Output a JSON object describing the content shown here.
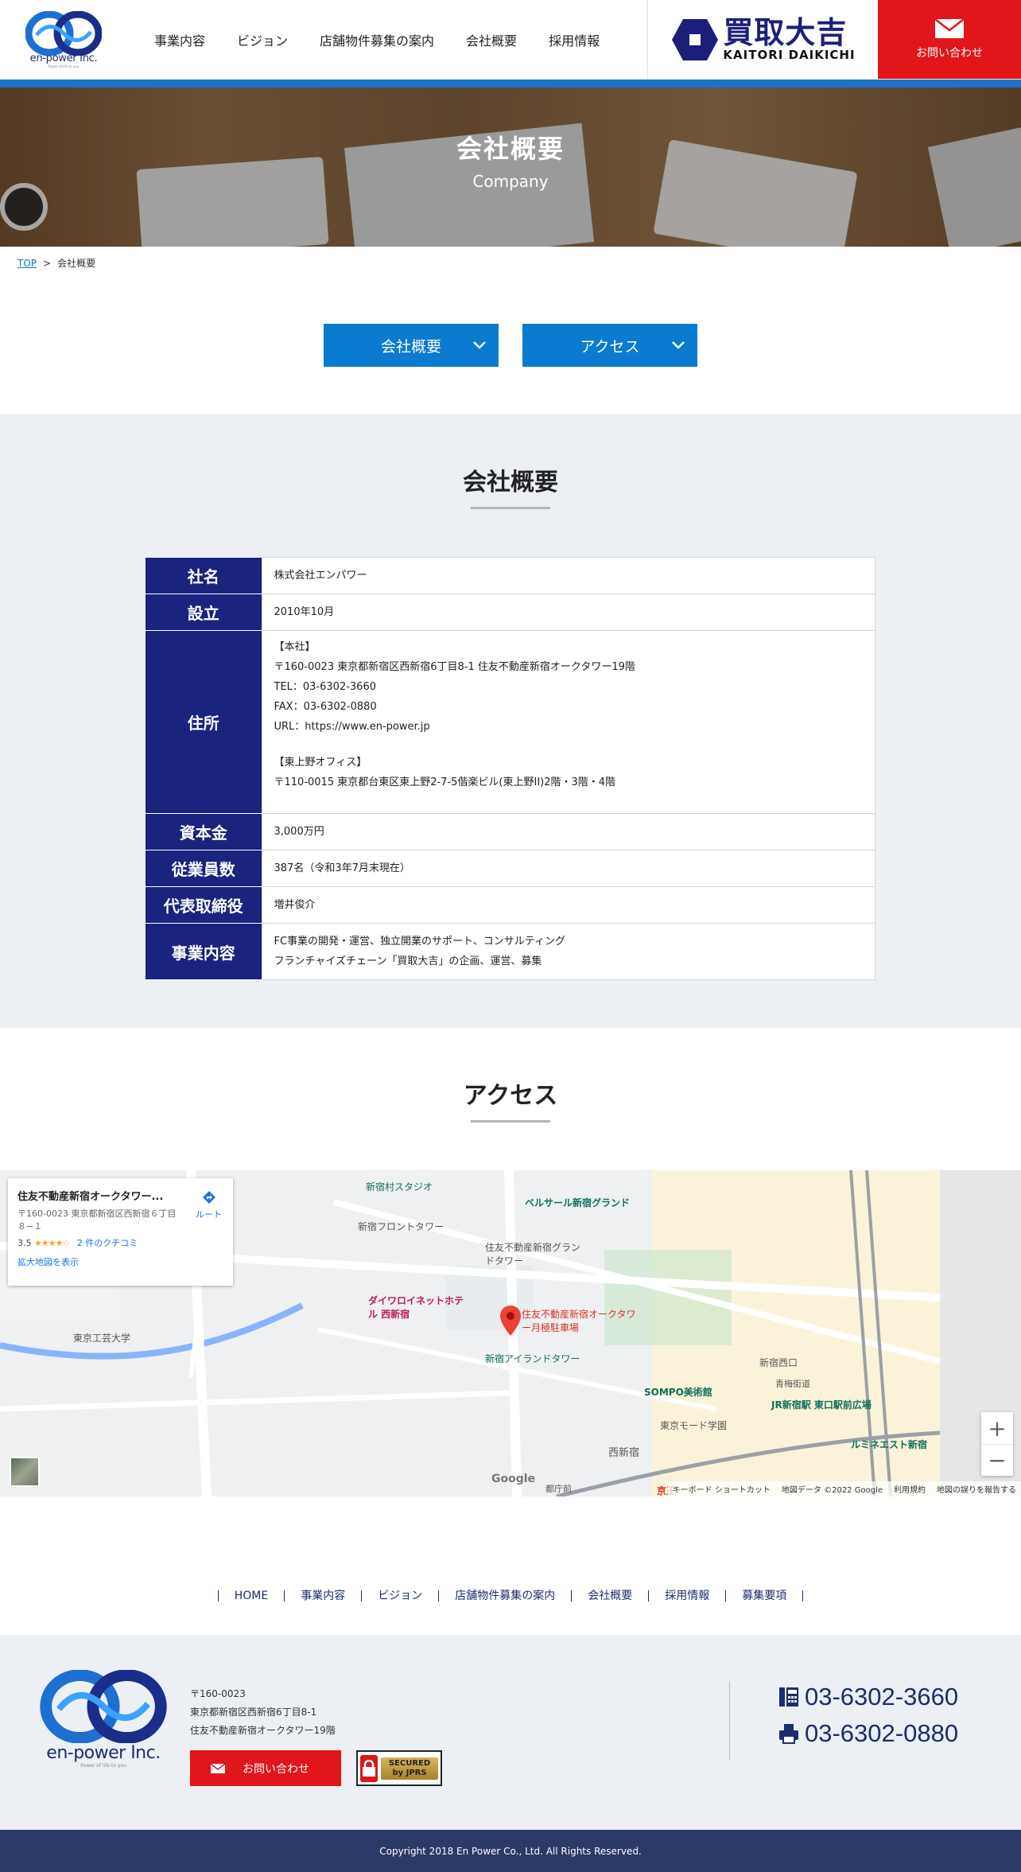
{
  "header": {
    "logo_text": "en-power Inc.",
    "logo_sub": "Power of life to you",
    "nav": [
      "事業内容",
      "ビジョン",
      "店舗物件募集の案内",
      "会社概要",
      "採用情報"
    ],
    "brand_jp": "買取大吉",
    "brand_en": "KAITORI DAIKICHI",
    "contact_label": "お問い合わせ"
  },
  "hero": {
    "title": "会社概要",
    "subtitle": "Company"
  },
  "breadcrumb": {
    "top": "TOP",
    "current": "会社概要"
  },
  "anchors": [
    "会社概要",
    "アクセス"
  ],
  "company": {
    "title": "会社概要",
    "rows": [
      {
        "label": "社名",
        "value": "株式会社エンパワー"
      },
      {
        "label": "設立",
        "value": "2010年10月"
      },
      {
        "label": "資本金",
        "value": "3,000万円"
      },
      {
        "label": "従業員数",
        "value": "387名（令和3年7月末現在）"
      },
      {
        "label": "代表取締役",
        "value": "増井俊介"
      }
    ],
    "address": {
      "label": "住所",
      "head_office": "【本社】",
      "head_addr": "〒160-0023 東京都新宿区西新宿6丁目8-1 住友不動産新宿オークタワー19階",
      "tel": "TEL：03-6302-3660",
      "fax": "FAX：03-6302-0880",
      "url": "URL：https://www.en-power.jp",
      "branch": "【東上野オフィス】",
      "branch_addr": "〒110-0015 東京都台東区東上野2-7-5偕楽ビル(東上野II)2階・3階・4階"
    },
    "business": {
      "label": "事業内容",
      "line1": "FC事業の開発・運営、独立開業のサポート、コンサルティング",
      "line2": "フランチャイズチェーン「買取大吉」の企画、運営、募集"
    }
  },
  "access": {
    "title": "アクセス",
    "map_card": {
      "title": "住友不動産新宿オークタワー...",
      "address": "〒160-0023 東京都新宿区西新宿６丁目８−１",
      "rating": "3.5",
      "stars": "★★★★☆",
      "reviews": "2 件のクチコミ",
      "large_map": "拡大地図を表示",
      "route": "ルート"
    },
    "map_labels": {
      "studio": "新宿村スタジオ",
      "bellesalle": "ベルサール新宿グランド",
      "front_tower": "新宿フロントタワー",
      "grand_tower": "住友不動産新宿グランドタワー",
      "daiwa": "ダイワロイネットホテル 西新宿",
      "target": "住友不動産新宿オークタワー月極駐車場",
      "island": "新宿アイランドタワー",
      "sompo": "SOMPO美術館",
      "jr": "JR新宿駅 東口駅前広場",
      "lumine": "ルミネエスト新宿",
      "mode": "東京モード学園",
      "nishishinjuku": "西新宿",
      "kogei": "東京工芸大学",
      "keio": "京王",
      "tochomae": "都庁前",
      "shinjuku_nishiguchi": "新宿西口",
      "ome": "青梅街道"
    },
    "map_footer": [
      "キーボード ショートカット",
      "地図データ ©2022 Google",
      "利用規約",
      "地図の誤りを報告する"
    ],
    "google": "Google"
  },
  "footer_nav": [
    "HOME",
    "事業内容",
    "ビジョン",
    "店舗物件募集の案内",
    "会社概要",
    "採用情報",
    "募集要項"
  ],
  "footer": {
    "logo_text": "en-power Inc.",
    "logo_sub": "Power of life to you",
    "zip": "〒160-0023",
    "addr1": "東京都新宿区西新宿6丁目8-1",
    "addr2": "住友不動産新宿オークタワー19階",
    "contact_label": "お問い合わせ",
    "secured": "SECURED by JPRS",
    "tel": "03-6302-3660",
    "fax": "03-6302-0880",
    "copyright": "Copyright 2018 En Power Co., Ltd. All Rights Reserved."
  },
  "colors": {
    "brand_navy": "#1a237e",
    "accent_blue": "#0b7ad1",
    "contact_red": "#e0161b"
  }
}
